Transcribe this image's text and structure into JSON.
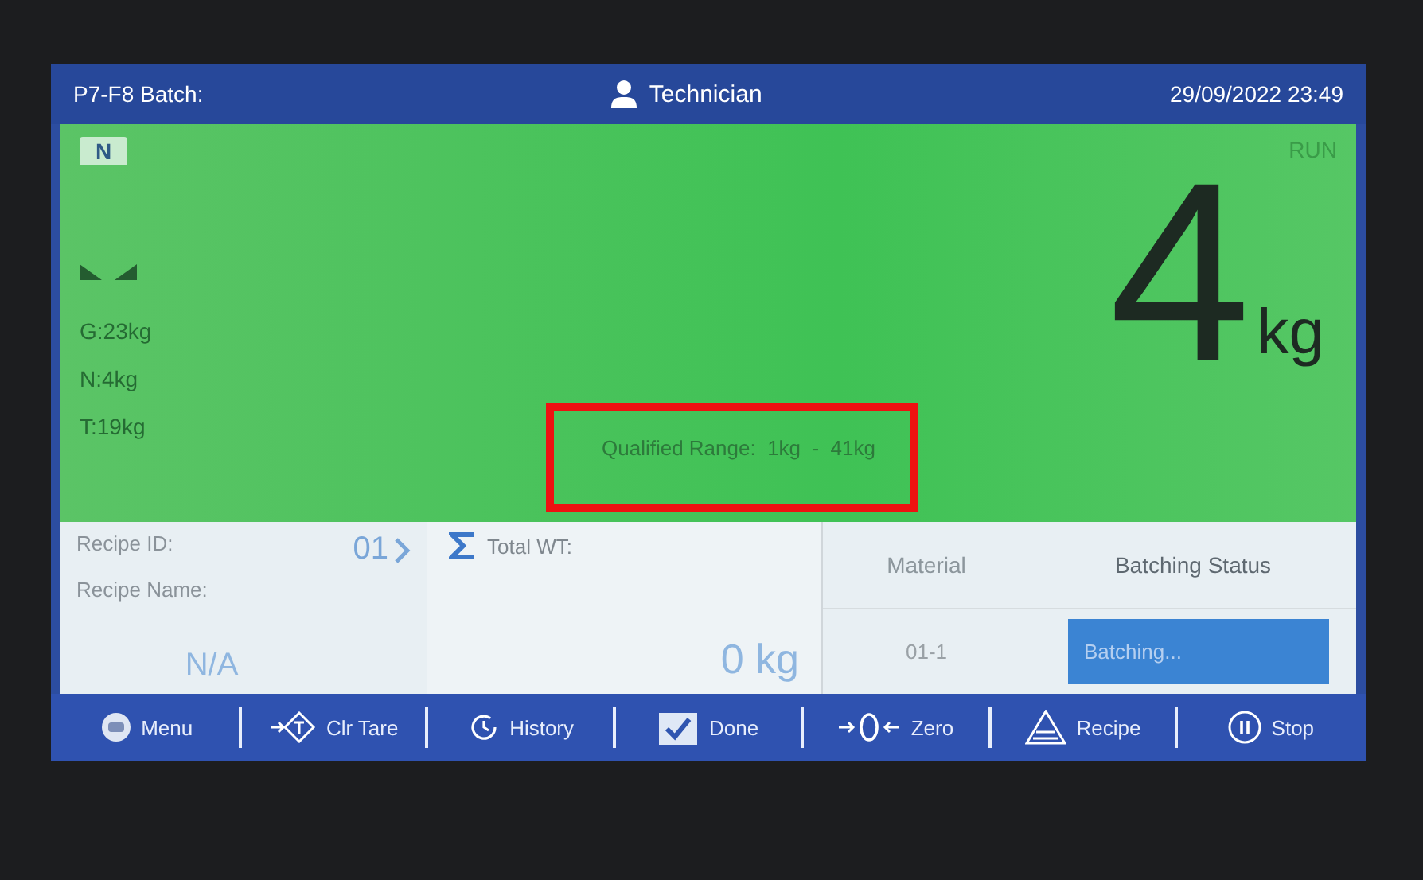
{
  "header": {
    "batch": "P7-F8 Batch:",
    "user": "Technician",
    "datetime": "29/09/2022 23:49"
  },
  "weighing": {
    "mode_badge": "N",
    "status": "RUN",
    "value": "4",
    "unit": "kg",
    "gross": "G:23kg",
    "net": "N:4kg",
    "tare": "T:19kg",
    "qualified_range": "Qualified Range:  1kg  -  41kg",
    "range_highlighted": true
  },
  "recipe": {
    "id_label": "Recipe ID:",
    "id_value": "01",
    "name_label": "Recipe Name:",
    "name_value": "N/A",
    "total_label": "Total WT:",
    "total_value": "0 kg"
  },
  "batch_table": {
    "columns": [
      "Material",
      "Batching Status"
    ],
    "rows": [
      {
        "material": "01-1",
        "status": "Batching..."
      }
    ]
  },
  "toolbar": [
    {
      "kind": "menu",
      "label": "Menu"
    },
    {
      "kind": "tare",
      "label": "Clr Tare"
    },
    {
      "kind": "history",
      "label": "History"
    },
    {
      "kind": "done",
      "label": "Done"
    },
    {
      "kind": "zero",
      "label": "Zero"
    },
    {
      "kind": "recipe",
      "label": "Recipe"
    },
    {
      "kind": "stop",
      "label": "Stop"
    }
  ]
}
